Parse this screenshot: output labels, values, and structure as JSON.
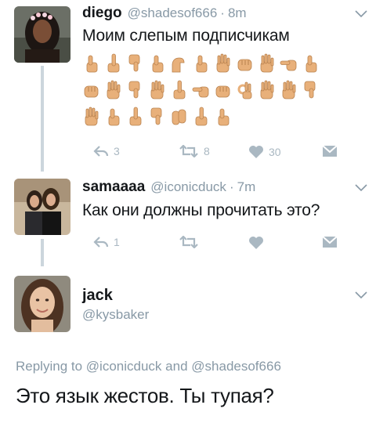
{
  "tweet1": {
    "name": "diego",
    "handle": "@shadesof666",
    "separator": "·",
    "time": "8m",
    "text": "Моим слепым подписчикам",
    "emoji_rows": [
      [
        "thumbs-up",
        "middle-finger",
        "thumbs-down",
        "thumbs-up",
        "flexed-biceps",
        "thumbs-up",
        "raised-hand",
        "fist",
        "raised-hand",
        "pointing-left",
        "thumbs-up"
      ],
      [
        "fist",
        "raised-hand",
        "thumbs-down",
        "raised-hand",
        "middle-finger",
        "pointing-left",
        "fist",
        "ok-hand",
        "raised-hand",
        "raised-hand",
        "thumbs-down"
      ],
      [
        "raised-hand",
        "thumbs-up",
        "middle-finger",
        "thumbs-down",
        "clapping-hands",
        "middle-finger",
        "thumbs-up"
      ]
    ],
    "actions": {
      "replies": "3",
      "retweets": "8",
      "likes": "30"
    }
  },
  "tweet2": {
    "name": "samaaaa",
    "handle": "@iconicduck",
    "separator": "·",
    "time": "7m",
    "text": "Как они должны прочитать это?",
    "actions": {
      "replies": "1",
      "retweets": "",
      "likes": ""
    }
  },
  "tweet3": {
    "name": "jack",
    "handle": "@kysbaker",
    "reply_prefix": "Replying to",
    "reply_user1": "@iconicduck",
    "reply_and": "and",
    "reply_user2": "@shadesof666",
    "text": "Это язык жестов. Ты тупая?"
  },
  "colors": {
    "muted": "#8899a6",
    "icon": "#aab8c2",
    "line": "#ccd6dd",
    "skin": "#e8b07a"
  }
}
